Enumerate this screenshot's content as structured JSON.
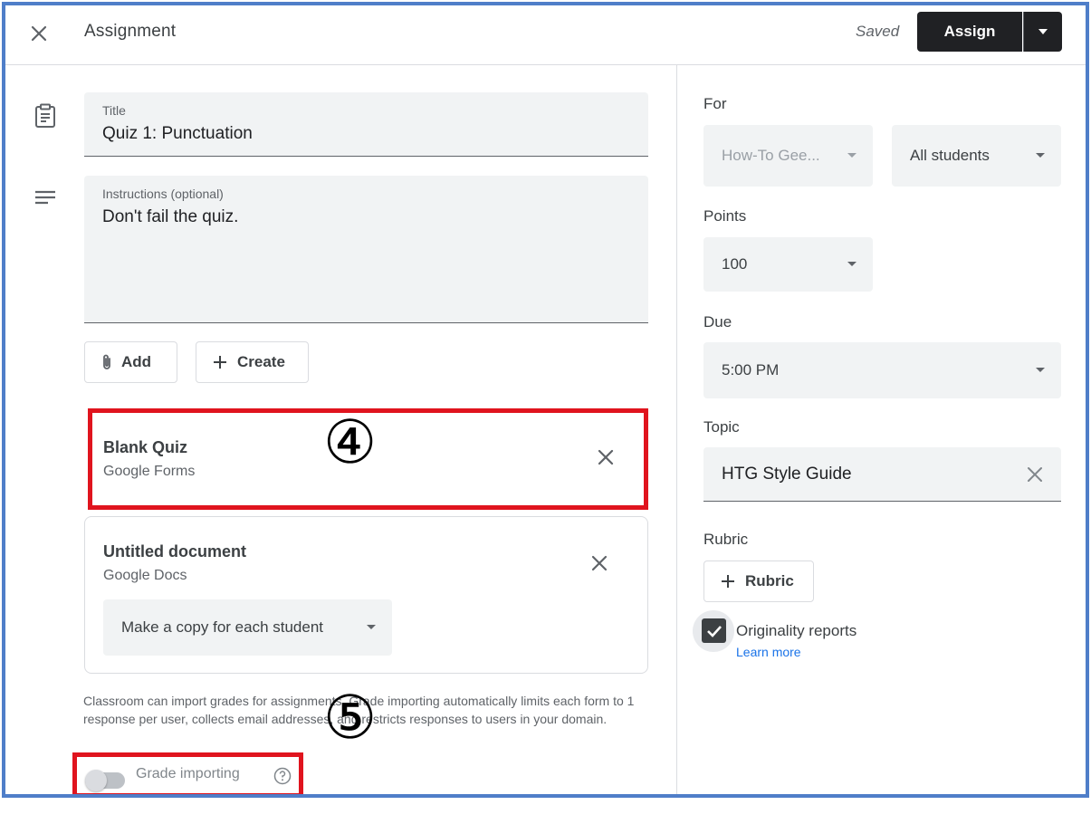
{
  "header": {
    "title": "Assignment",
    "saved": "Saved",
    "assign_label": "Assign"
  },
  "title_field": {
    "label": "Title",
    "value": "Quiz 1: Punctuation"
  },
  "instructions_field": {
    "label": "Instructions (optional)",
    "value": "Don't fail the quiz."
  },
  "actions": {
    "add_label": "Add",
    "create_label": "Create"
  },
  "attachments": [
    {
      "title": "Blank Quiz",
      "subtitle": "Google Forms"
    },
    {
      "title": "Untitled document",
      "subtitle": "Google Docs",
      "option": "Make a copy for each student"
    }
  ],
  "annotations": {
    "step4": "④",
    "step5": "⑤"
  },
  "grade_note": "Classroom can import grades for assignments. Grade importing automatically limits each form to 1 response per user, collects email addresses, and restricts responses to users in your domain.",
  "grade_importing": {
    "label": "Grade importing",
    "enabled": false
  },
  "sidebar": {
    "for_label": "For",
    "class_value": "How-To Gee...",
    "students_value": "All students",
    "points_label": "Points",
    "points_value": "100",
    "due_label": "Due",
    "due_value": "5:00 PM",
    "topic_label": "Topic",
    "topic_value": "HTG Style Guide",
    "rubric_label": "Rubric",
    "rubric_button": "Rubric",
    "originality_label": "Originality reports",
    "originality_checked": true,
    "learn_more": "Learn more"
  },
  "colors": {
    "accent": "#202124",
    "highlight": "#e0141e",
    "frame": "#4f7ec9",
    "link": "#1a73e8"
  }
}
